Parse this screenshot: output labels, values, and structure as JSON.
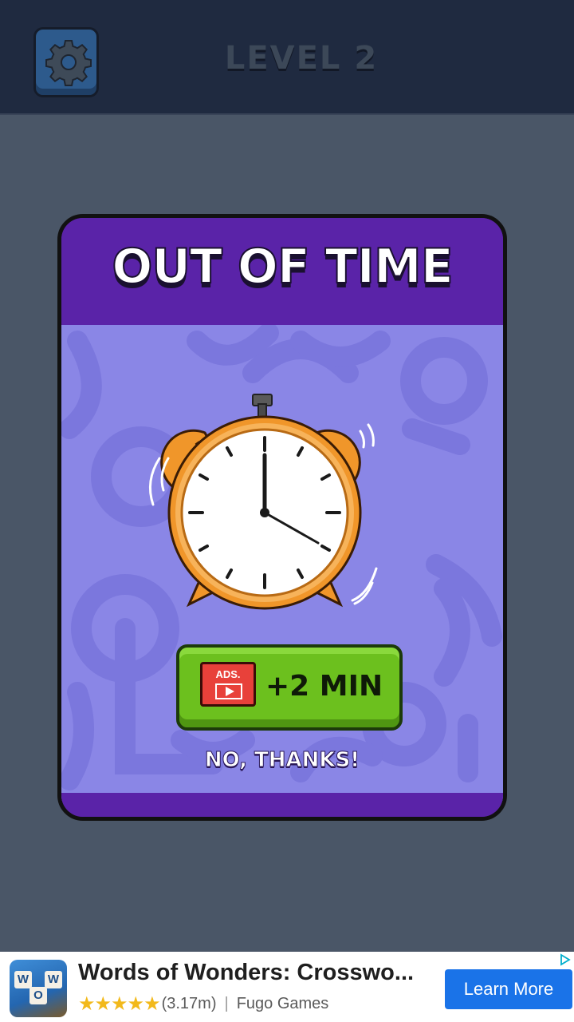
{
  "header": {
    "level_title": "LEVEL 2",
    "settings_icon": "gear-icon"
  },
  "dialog": {
    "title": "OUT OF TIME",
    "clock_icon": "alarm-clock-icon",
    "ad_button": {
      "icon_label": "ADS.",
      "label": "+2 MIN"
    },
    "no_thanks": "NO, THANKS!"
  },
  "ad_banner": {
    "app_name": "Words of Wonders: Crosswo...",
    "stars": "★★★★★",
    "rating_count": "(3.17m)",
    "separator": "|",
    "developer": "Fugo Games",
    "cta": "Learn More",
    "icon_letters": [
      "W",
      "O",
      "W"
    ]
  },
  "colors": {
    "background": "#4a5667",
    "topbar": "#1f2a40",
    "dialog_header": "#5a23a8",
    "dialog_body": "#8a86e6",
    "ad_button": "#6cc01e",
    "cta_button": "#1a73e8",
    "clock_body": "#f0962a"
  }
}
